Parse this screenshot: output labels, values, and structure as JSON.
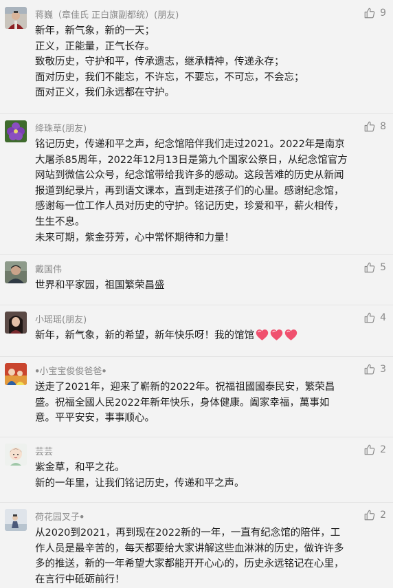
{
  "comments": [
    {
      "username": "蒋巍（章佳氏 正白旗副都统）(朋友)",
      "likes": "9",
      "avatar_icon": "avatar-person-photo-icon",
      "lines": [
        "新年，新气象，新的一天；",
        "正义，正能量，正气长存。",
        "致敬历史，守护和平，传承遗志，继承精神，传递永存；",
        "面对历史，我们不能忘，不许忘，不要忘，不可忘，不会忘；",
        "面对正义，我们永远都在守护。"
      ]
    },
    {
      "username": "绛珠草(朋友)",
      "likes": "8",
      "avatar_icon": "avatar-purple-flower-icon",
      "lines": [
        "铭记历史，传递和平之声，纪念馆陪伴我们走过2021。2022年是南京",
        "大屠杀85周年，2022年12月13日是第九个国家公祭日，从纪念馆官方",
        "网站到微信公众号，纪念馆带给我许多的感动。这段苦难的历史从新闻",
        "报道到纪录片，再到语文课本，直到走进孩子们的心里。感谢纪念馆，",
        "感谢每一位工作人员对历史的守护。铭记历史，珍爱和平，薪火相传，",
        "生生不息。",
        "未来可期，紫金芬芳，心中常怀期待和力量！"
      ]
    },
    {
      "username": "戴国伟",
      "likes": "5",
      "avatar_icon": "avatar-person-photo-icon",
      "lines": [
        "世界和平家园，祖国繁荣昌盛"
      ]
    },
    {
      "username": "小瑶瑶(朋友)",
      "likes": "4",
      "avatar_icon": "avatar-girl-photo-icon",
      "lines": [
        "新年，新气象，新的希望，新年快乐呀！我的馆馆"
      ],
      "heart_emoji_count": 3
    },
    {
      "username": "ꔷ小宝宝俊俊爸爸ꔷ",
      "likes": "3",
      "avatar_icon": "avatar-family-photo-icon",
      "lines": [
        "送走了2021年，迎来了嶄新的2022年。祝福祖國國泰民安，繁荣昌",
        "盛。祝福全國人民2022年新年快乐，身体健康。阖家幸福，萬事如",
        "意。平平安安，事事顺心。"
      ]
    },
    {
      "username": "芸芸",
      "likes": "2",
      "avatar_icon": "avatar-cartoon-girl-icon",
      "lines": [
        "紫金草，和平之花。",
        "新的一年里，让我们铭记历史，传递和平之声。"
      ]
    },
    {
      "username": "荷花园叉子ꔷ",
      "likes": "2",
      "avatar_icon": "avatar-person-photo-icon",
      "lines": [
        "从2020到2021，再到现在2022新的一年，一直有纪念馆的陪伴，工",
        "作人员是最辛苦的，每天都要给大家讲解这些血淋淋的历史，做许许多",
        "多的推送，新的一年希望大家都能开开心心的，历史永远铭记在心里，",
        "在言行中砥砺前行！"
      ]
    }
  ]
}
